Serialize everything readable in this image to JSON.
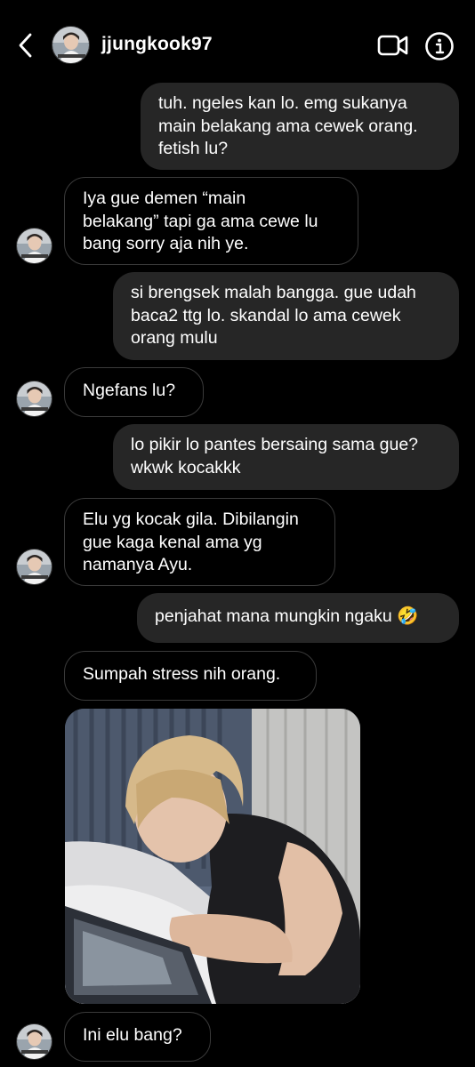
{
  "header": {
    "username": "jjungkook97",
    "back_icon": "chevron-left-icon",
    "video_icon": "video-camera-icon",
    "info_icon": "info-icon"
  },
  "messages": [
    {
      "direction": "out",
      "text": "tuh. ngeles kan lo. emg sukanya\nmain belakang ama cewek orang.\nfetish lu?"
    },
    {
      "direction": "in",
      "text": "Iya gue demen “main\nbelakang” tapi ga ama cewe lu\nbang sorry aja nih ye."
    },
    {
      "direction": "out",
      "text": "si brengsek malah bangga. gue udah\nbaca2 ttg lo. skandal lo ama cewek\norang mulu"
    },
    {
      "direction": "in",
      "text": "Ngefans lu?"
    },
    {
      "direction": "out",
      "text": "lo pikir lo pantes bersaing sama gue?\nwkwk kocakkk"
    },
    {
      "direction": "in",
      "text": "Elu yg kocak gila. Dibilangin\ngue kaga kenal ama yg\nnamanya Ayu."
    },
    {
      "direction": "out",
      "text": "penjahat mana mungkin ngaku 🤣"
    },
    {
      "direction": "in",
      "text": "Sumpah stress nih orang."
    },
    {
      "direction": "in",
      "type": "photo"
    },
    {
      "direction": "in",
      "text": "Ini elu bang?"
    }
  ],
  "colors": {
    "background": "#000000",
    "outgoing_bubble": "#262626",
    "incoming_border": "#3a3a3a",
    "text": "#ffffff"
  }
}
